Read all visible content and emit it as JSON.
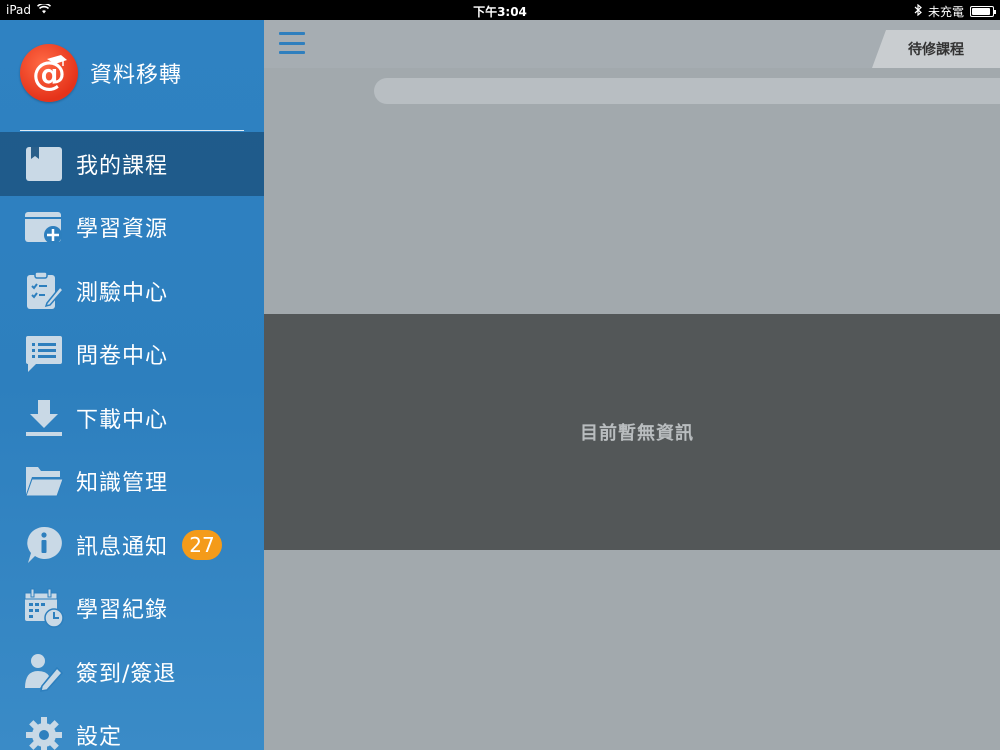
{
  "status_bar": {
    "device": "iPad",
    "time": "下午3:04",
    "charging": "未充電"
  },
  "sidebar": {
    "brand_title": "資料移轉",
    "items": [
      {
        "label": "我的課程",
        "icon": "book-icon",
        "active": true
      },
      {
        "label": "學習資源",
        "icon": "folder-add-icon"
      },
      {
        "label": "測驗中心",
        "icon": "clipboard-edit-icon"
      },
      {
        "label": "問卷中心",
        "icon": "chat-list-icon"
      },
      {
        "label": "下載中心",
        "icon": "download-icon"
      },
      {
        "label": "知識管理",
        "icon": "folder-open-icon"
      },
      {
        "label": "訊息通知",
        "icon": "info-bubble-icon",
        "badge": "27"
      },
      {
        "label": "學習紀錄",
        "icon": "calendar-clock-icon"
      },
      {
        "label": "簽到/簽退",
        "icon": "user-edit-icon"
      },
      {
        "label": "設定",
        "icon": "gear-icon"
      }
    ]
  },
  "main": {
    "tab_label": "待修課程",
    "empty_message": "目前暫無資訊"
  },
  "colors": {
    "sidebar_blue": "#2f82c2",
    "badge_orange": "#f49b1a",
    "logo_red": "#e5331a",
    "panel_dark": "#535758",
    "content_gray": "#a2a9ad"
  }
}
